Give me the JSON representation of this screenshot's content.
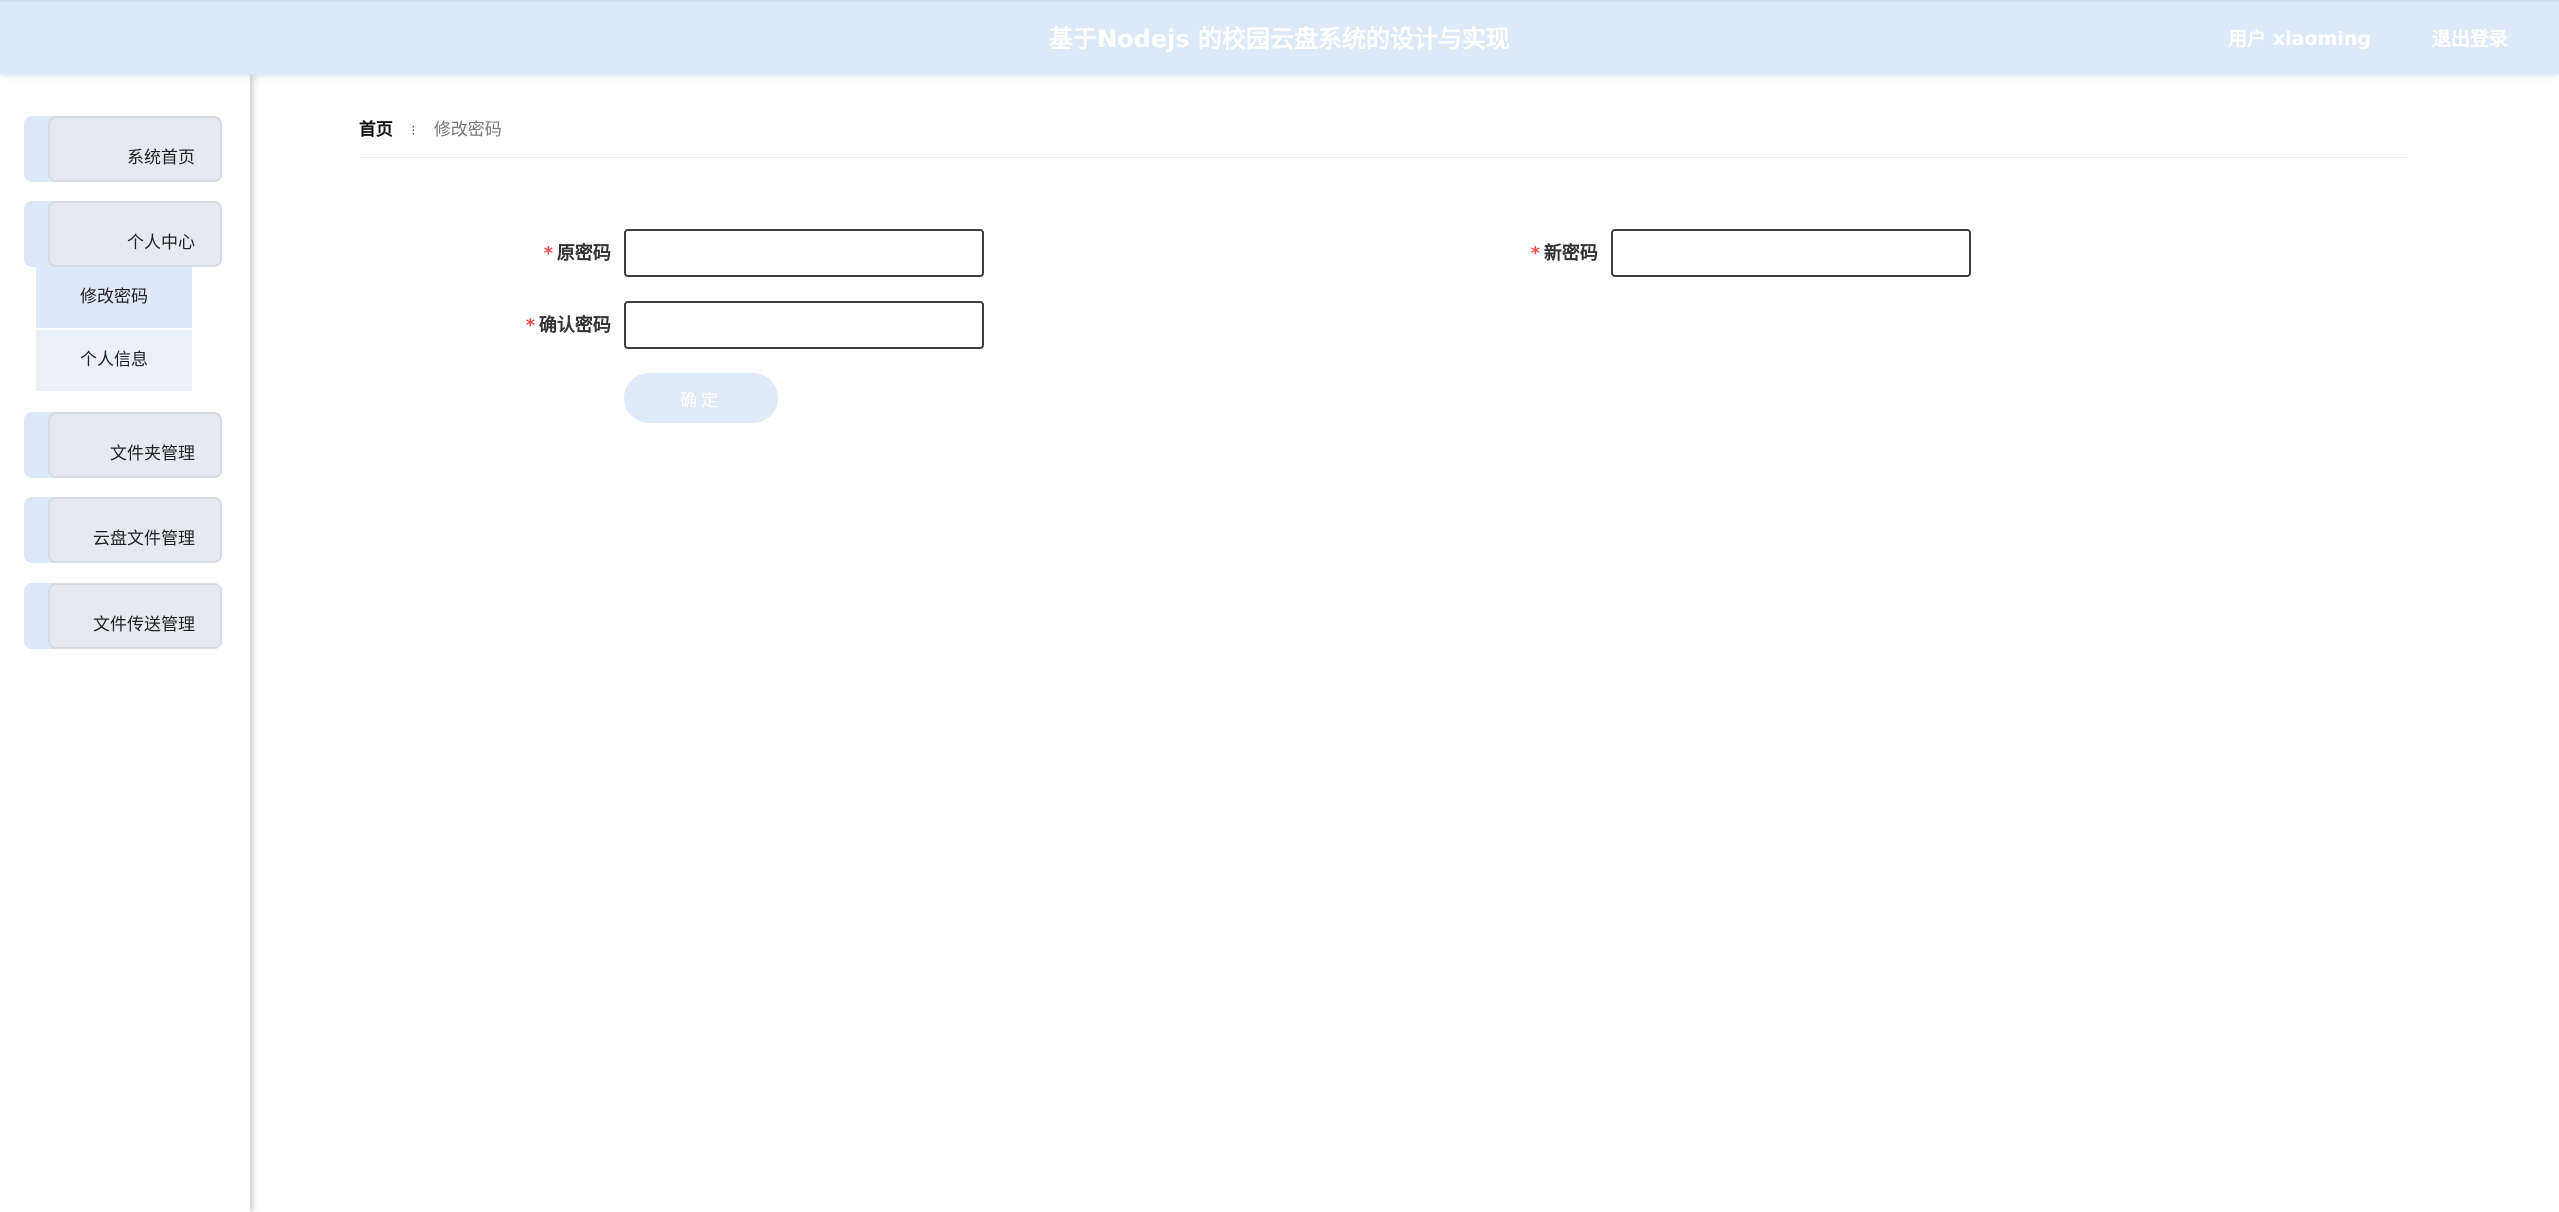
{
  "header": {
    "title": "基于Nodejs 的校园云盘系统的设计与实现",
    "user": "用户 xiaoming",
    "logout": "退出登录"
  },
  "sidebar": {
    "items": [
      {
        "label": "系统首页"
      },
      {
        "label": "个人中心",
        "children": [
          {
            "label": "修改密码",
            "active": true
          },
          {
            "label": "个人信息"
          }
        ]
      },
      {
        "label": "文件夹管理"
      },
      {
        "label": "云盘文件管理"
      },
      {
        "label": "文件传送管理"
      }
    ]
  },
  "breadcrumb": {
    "home": "首页",
    "separator": "⁝",
    "current": "修改密码"
  },
  "form": {
    "required_mark": "*",
    "old_password_label": "原密码",
    "new_password_label": "新密码",
    "confirm_password_label": "确认密码",
    "old_password_value": "",
    "new_password_value": "",
    "confirm_password_value": "",
    "submit_label": "确定"
  },
  "colors": {
    "header_bg": "#dbe9f8",
    "required": "#ef4f4f",
    "submit_bg": "#deeaf8"
  }
}
